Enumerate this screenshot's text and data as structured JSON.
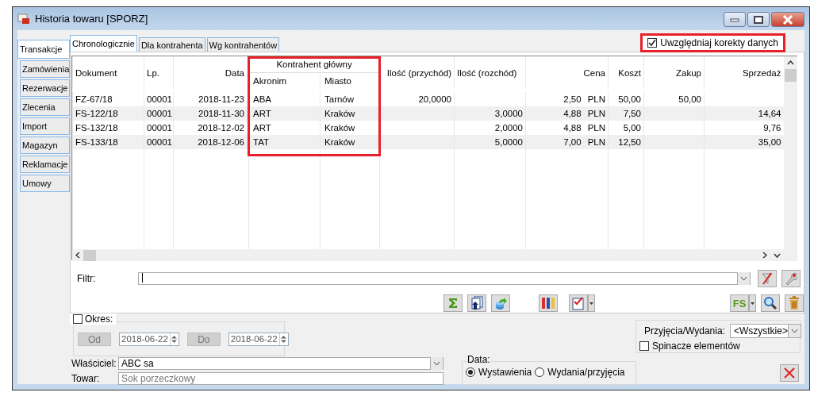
{
  "window": {
    "title": "Historia towaru [SPORZ]"
  },
  "side_tabs": [
    {
      "label": "Transakcje",
      "selected": true
    },
    {
      "label": "Zamówienia",
      "selected": false
    },
    {
      "label": "Rezerwacje",
      "selected": false
    },
    {
      "label": "Zlecenia",
      "selected": false
    },
    {
      "label": "Import",
      "selected": false
    },
    {
      "label": "Magazyn",
      "selected": false
    },
    {
      "label": "Reklamacje",
      "selected": false
    },
    {
      "label": "Umowy",
      "selected": false
    }
  ],
  "tabs": [
    {
      "label": "Chronologicznie",
      "selected": true
    },
    {
      "label": "Dla kontrahenta",
      "selected": false
    },
    {
      "label": "Wg kontrahentów",
      "selected": false
    }
  ],
  "include_corrections": {
    "label": "Uwzględniaj korekty danych",
    "checked": true
  },
  "table": {
    "group_header": "Kontrahent główny",
    "columns": [
      "Dokument",
      "Lp.",
      "Data",
      "Akronim",
      "Miasto",
      "Ilość (przychód)",
      "Ilość (rozchód)",
      "Cena",
      "Koszt",
      "Zakup",
      "Sprzedaż"
    ],
    "rows": [
      {
        "cells": [
          "FZ-67/18",
          "00001",
          "2018-11-23",
          "ABA",
          "Tarnów",
          "20,0000",
          null,
          "2,50",
          "50,00",
          "50,00",
          null
        ],
        "currency": "PLN"
      },
      {
        "cells": [
          "FS-122/18",
          "00001",
          "2018-11-30",
          "ART",
          "Kraków",
          null,
          "3,0000",
          "4,88",
          "7,50",
          null,
          "14,64"
        ],
        "currency": "PLN"
      },
      {
        "cells": [
          "FS-132/18",
          "00001",
          "2018-12-02",
          "ART",
          "Kraków",
          null,
          "2,0000",
          "4,88",
          "5,00",
          null,
          "9,76"
        ],
        "currency": "PLN"
      },
      {
        "cells": [
          "FS-133/18",
          "00001",
          "2018-12-06",
          "TAT",
          "Kraków",
          null,
          "5,0000",
          "7,00",
          "12,50",
          null,
          "35,00"
        ],
        "currency": "PLN"
      }
    ]
  },
  "filter": {
    "label": "Filtr:"
  },
  "fs_button": {
    "label": "FS"
  },
  "period": {
    "label": "Okres:",
    "checked": false,
    "from_button": "Od",
    "from": "2018-06-22",
    "to_button": "Do",
    "to": "2018-06-22"
  },
  "owner": {
    "label": "Właściciel:",
    "value": "ABC sa"
  },
  "product": {
    "label": "Towar:",
    "value": "Sok porzeczkowy",
    "disabled": true
  },
  "date_type": {
    "label": "Data:",
    "options": [
      {
        "label": "Wystawienia",
        "selected": true
      },
      {
        "label": "Wydania/przyjęcia",
        "selected": false
      }
    ]
  },
  "direction": {
    "label": "Przyjęcia/Wydania:",
    "value": "<Wszystkie>"
  },
  "clips": {
    "label": "Spinacze elementów",
    "checked": false
  }
}
